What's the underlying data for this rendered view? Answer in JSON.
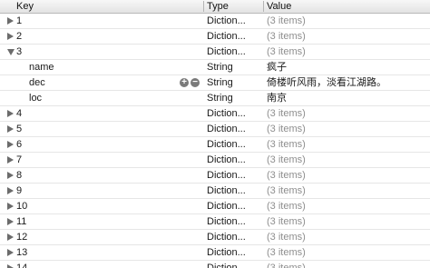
{
  "columns": {
    "key": "Key",
    "type": "Type",
    "value": "Value"
  },
  "rows": [
    {
      "key": "1",
      "type": "Diction...",
      "value": "(3 items)",
      "level": 0,
      "state": "closed"
    },
    {
      "key": "2",
      "type": "Diction...",
      "value": "(3 items)",
      "level": 0,
      "state": "closed"
    },
    {
      "key": "3",
      "type": "Diction...",
      "value": "(3 items)",
      "level": 0,
      "state": "open"
    },
    {
      "key": "name",
      "type": "String",
      "value": "疯子",
      "level": 1
    },
    {
      "key": "dec",
      "type": "String",
      "value": "倚楼听风雨，淡看江湖路。",
      "level": 1,
      "buttons": [
        "add-icon",
        "remove-icon"
      ]
    },
    {
      "key": "loc",
      "type": "String",
      "value": "南京",
      "level": 1
    },
    {
      "key": "4",
      "type": "Diction...",
      "value": "(3 items)",
      "level": 0,
      "state": "closed"
    },
    {
      "key": "5",
      "type": "Diction...",
      "value": "(3 items)",
      "level": 0,
      "state": "closed"
    },
    {
      "key": "6",
      "type": "Diction...",
      "value": "(3 items)",
      "level": 0,
      "state": "closed"
    },
    {
      "key": "7",
      "type": "Diction...",
      "value": "(3 items)",
      "level": 0,
      "state": "closed"
    },
    {
      "key": "8",
      "type": "Diction...",
      "value": "(3 items)",
      "level": 0,
      "state": "closed"
    },
    {
      "key": "9",
      "type": "Diction...",
      "value": "(3 items)",
      "level": 0,
      "state": "closed"
    },
    {
      "key": "10",
      "type": "Diction...",
      "value": "(3 items)",
      "level": 0,
      "state": "closed"
    },
    {
      "key": "11",
      "type": "Diction...",
      "value": "(3 items)",
      "level": 0,
      "state": "closed"
    },
    {
      "key": "12",
      "type": "Diction...",
      "value": "(3 items)",
      "level": 0,
      "state": "closed"
    },
    {
      "key": "13",
      "type": "Diction...",
      "value": "(3 items)",
      "level": 0,
      "state": "closed"
    },
    {
      "key": "14",
      "type": "Diction...",
      "value": "(3 items)",
      "level": 0,
      "state": "closed"
    }
  ],
  "colors": {
    "muted_text": "#8e8e8e",
    "triangle": "#6b6b6b",
    "row_border": "#e6e6e6"
  }
}
